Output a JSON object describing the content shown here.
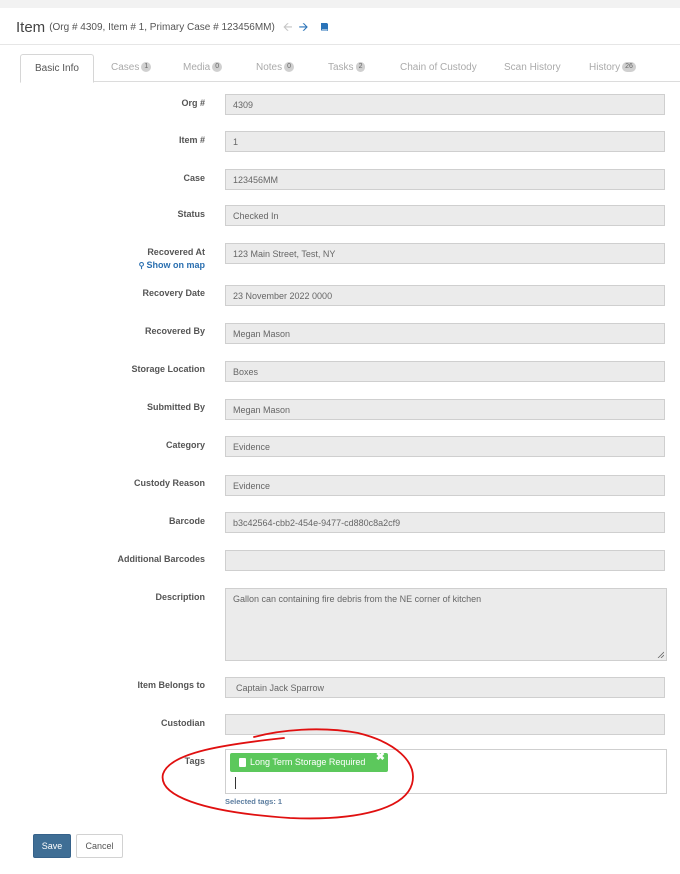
{
  "header": {
    "title": "Item",
    "subtitle": "(Org # 4309, Item # 1, Primary Case # 123456MM)",
    "icons": [
      "arrow-left-icon",
      "arrow-right-icon",
      "book-icon"
    ]
  },
  "tabs": [
    {
      "label": "Basic Info",
      "count": null
    },
    {
      "label": "Cases",
      "count": "1"
    },
    {
      "label": "Media",
      "count": "0"
    },
    {
      "label": "Notes",
      "count": "0"
    },
    {
      "label": "Tasks",
      "count": "2"
    },
    {
      "label": "Chain of Custody",
      "count": null
    },
    {
      "label": "Scan History",
      "count": null
    },
    {
      "label": "History",
      "count": "26"
    }
  ],
  "fields": {
    "org": {
      "label": "Org #",
      "value": "4309"
    },
    "item": {
      "label": "Item #",
      "value": "1"
    },
    "case": {
      "label": "Case",
      "value": "123456MM"
    },
    "status": {
      "label": "Status",
      "value": "Checked In"
    },
    "recovered_at": {
      "label": "Recovered At",
      "value": "123 Main Street, Test, NY",
      "map_link": "Show on map"
    },
    "recovery_date": {
      "label": "Recovery Date",
      "value": "23 November 2022 0000"
    },
    "recovered_by": {
      "label": "Recovered By",
      "value": "Megan Mason"
    },
    "storage_location": {
      "label": "Storage Location",
      "value": "Boxes"
    },
    "submitted_by": {
      "label": "Submitted By",
      "value": "Megan Mason"
    },
    "category": {
      "label": "Category",
      "value": "Evidence"
    },
    "custody_reason": {
      "label": "Custody Reason",
      "value": "Evidence"
    },
    "barcode": {
      "label": "Barcode",
      "value": "b3c42564-cbb2-454e-9477-cd880c8a2cf9"
    },
    "additional_barcodes": {
      "label": "Additional Barcodes",
      "value": ""
    },
    "description": {
      "label": "Description",
      "value": "Gallon can containing fire debris from the NE corner of kitchen"
    },
    "item_belongs_to": {
      "label": "Item Belongs to",
      "value": "Captain Jack Sparrow"
    },
    "custodian": {
      "label": "Custodian",
      "value": ""
    }
  },
  "tags": {
    "label": "Tags",
    "items": [
      "Long Term Storage Required"
    ],
    "selected_text": "Selected tags: 1",
    "tag_color": "#5cc85c"
  },
  "buttons": {
    "save": "Save",
    "cancel": "Cancel"
  },
  "colors": {
    "accent": "#3f6e95",
    "link": "#2a6fb0",
    "annotation": "#e01010"
  }
}
